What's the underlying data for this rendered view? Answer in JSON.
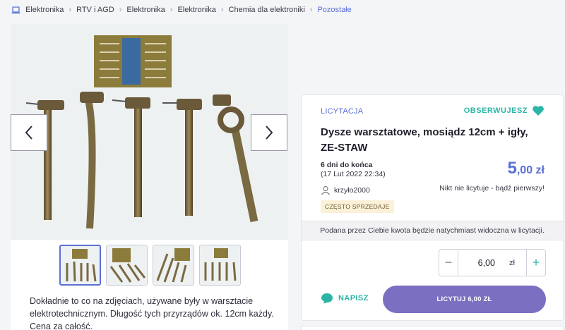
{
  "breadcrumb": {
    "items": [
      "Elektronika",
      "RTV i AGD",
      "Elektronika",
      "Elektronika",
      "Chemia dla elektroniki",
      "Pozostałe"
    ]
  },
  "gallery": {
    "thumbnail_count": 4,
    "active_thumbnail": 1
  },
  "description": {
    "text": "Dokładnie to co na zdjęciach, używane były w warsztacie elektrotechnicznym. Długość tych przyrządów ok. 12cm każdy. Cena za całość."
  },
  "offer": {
    "type_label": "LICYTACJA",
    "watch_label": "OBSERWUJESZ",
    "title": "Dysze warsztatowe, mosiądz 12cm + igły, ZE-STAW",
    "time_left": "6 dni do końca",
    "end_date": "(17 Lut 2022 22:34)",
    "price_main": "5",
    "price_fraction": ",00 zł",
    "no_bids_text": "Nikt nie licytuje - bądź pierwszy!",
    "seller": "krzyło2000",
    "seller_badge": "CZĘSTO SPRZEDAJE",
    "info_text": "Podana przez Ciebie kwota będzie natychmiast widoczna w licytacji.",
    "bid_amount": "6,00",
    "bid_unit": "zł",
    "minus_symbol": "−",
    "plus_symbol": "+",
    "message_label": "NAPISZ",
    "bid_button_label": "LICYTUJ 6,00 ZŁ"
  },
  "colors": {
    "accent": "#5a6fd6",
    "teal": "#2cb5a6",
    "bid_button": "#7a6fc0"
  },
  "icons": {
    "breadcrumb": "laptop-icon",
    "prev": "chevron-left-icon",
    "next": "chevron-right-icon",
    "watch": "heart-icon",
    "seller": "user-icon",
    "message": "chat-bubble-icon"
  }
}
